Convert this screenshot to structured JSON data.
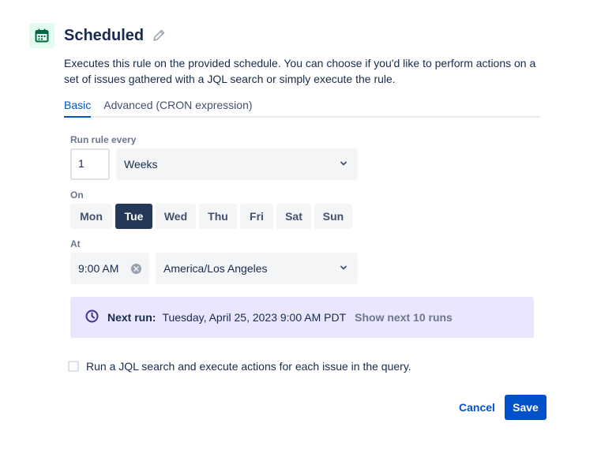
{
  "header": {
    "icon": "calendar-icon",
    "title": "Scheduled",
    "edit_icon": "pencil-icon"
  },
  "description": "Executes this rule on the provided schedule. You can choose if you'd like to perform actions on a set of issues gathered with a JQL search or simply execute the rule.",
  "tabs": [
    {
      "label": "Basic",
      "active": true
    },
    {
      "label": "Advanced (CRON expression)",
      "active": false
    }
  ],
  "run_every": {
    "label": "Run rule every",
    "value": "1",
    "unit": "Weeks",
    "unit_icon": "chevron-down-icon"
  },
  "on": {
    "label": "On",
    "days": [
      {
        "label": "Mon",
        "selected": false
      },
      {
        "label": "Tue",
        "selected": true
      },
      {
        "label": "Wed",
        "selected": false
      },
      {
        "label": "Thu",
        "selected": false
      },
      {
        "label": "Fri",
        "selected": false
      },
      {
        "label": "Sat",
        "selected": false
      },
      {
        "label": "Sun",
        "selected": false
      }
    ]
  },
  "at": {
    "label": "At",
    "time": "9:00 AM",
    "clear_icon": "clear-icon",
    "timezone": "America/Los Angeles",
    "timezone_icon": "chevron-down-icon"
  },
  "next_run": {
    "icon": "clock-icon",
    "label": "Next run:",
    "value": "Tuesday, April 25, 2023 9:00 AM PDT",
    "link": "Show next 10 runs"
  },
  "jql": {
    "checked": false,
    "label": "Run a JQL search and execute actions for each issue in the query."
  },
  "actions": {
    "cancel": "Cancel",
    "save": "Save"
  },
  "colors": {
    "primary": "#0052cc",
    "selected_day": "#253858",
    "next_run_bg": "#eae6ff",
    "clock": "#403294",
    "calendar": "#006644"
  }
}
